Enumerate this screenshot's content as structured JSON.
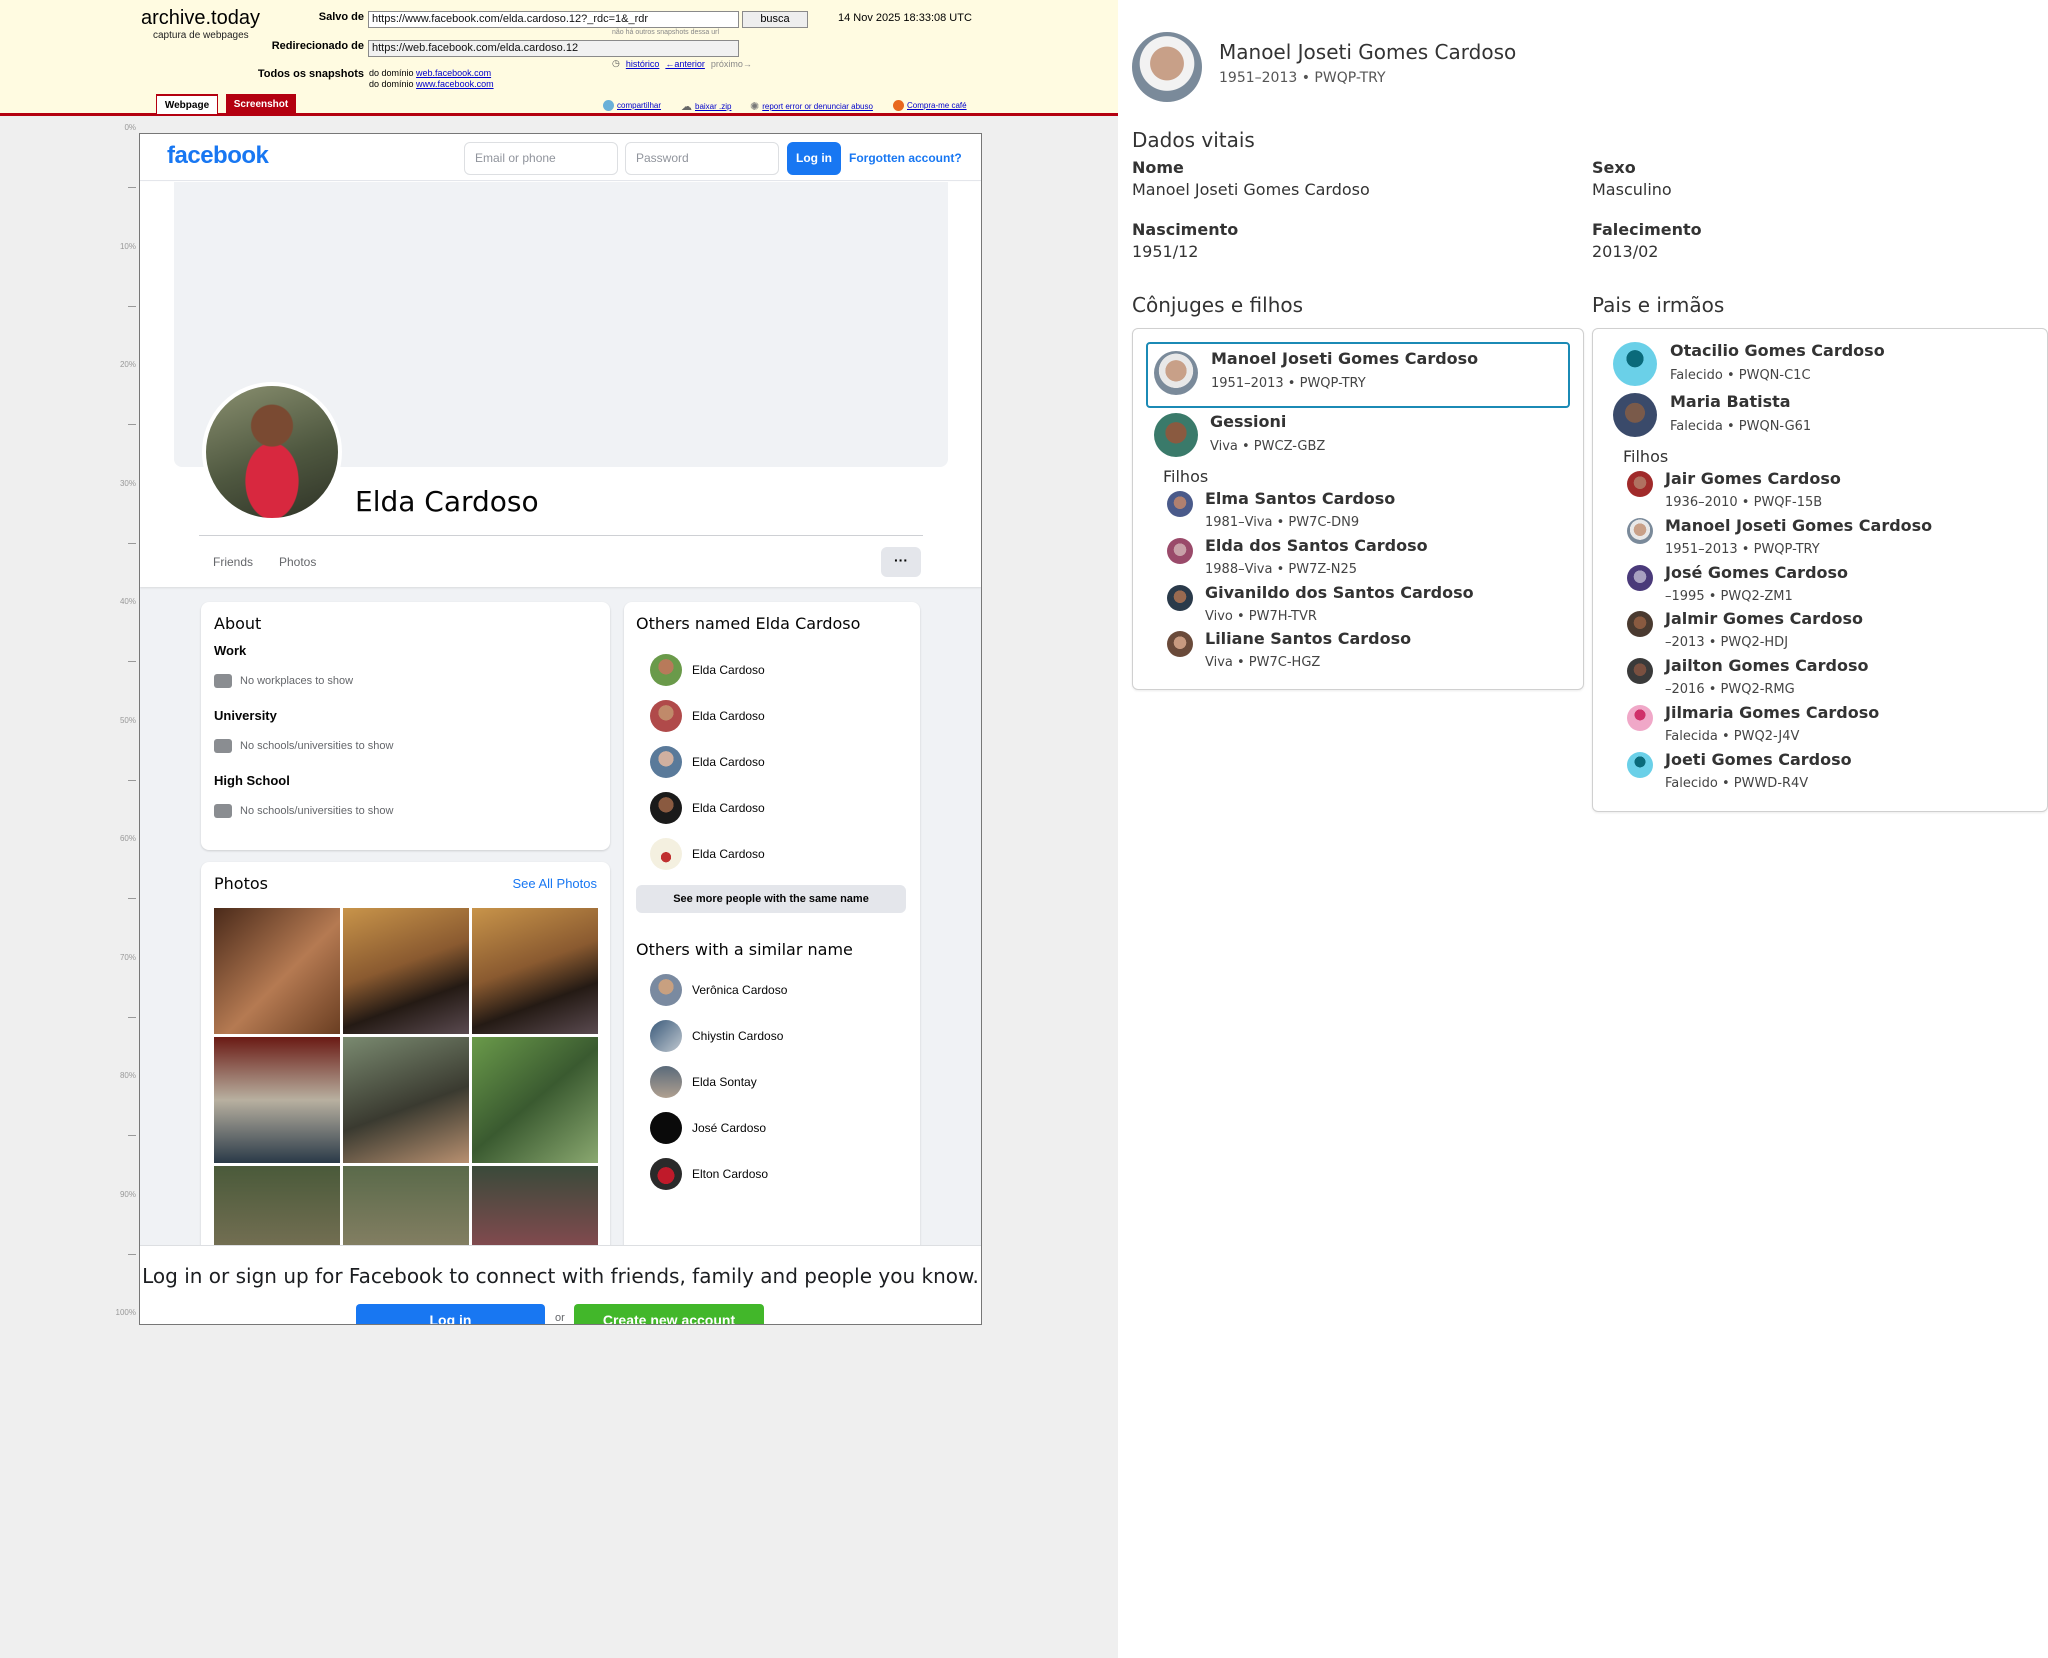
{
  "archive": {
    "logo": "archive.today",
    "tagline": "captura de webpages",
    "saved_label": "Salvo de",
    "saved_url": "https://www.facebook.com/elda.cardoso.12?_rdc=1&_rdr",
    "search_button": "busca",
    "timestamp": "14 Nov 2025 18:33:08 UTC",
    "no_other_snapshots": "não há outros snapshots dessa url",
    "redirected_label": "Redirecionado de",
    "redirected_url": "https://web.facebook.com/elda.cardoso.12",
    "history_link": "histórico",
    "prev_link": "←anterior",
    "next_link": "próximo→",
    "all_snapshots_label": "Todos os snapshots",
    "domain_prefix_1": "do domínio",
    "domain_1": "web.facebook.com",
    "domain_prefix_2": "do domínio",
    "domain_2": "www.facebook.com",
    "tab_webpage": "Webpage",
    "tab_screenshot": "Screenshot",
    "share": "compartilhar",
    "download": "baixar .zip",
    "report": "report error or denunciar abuso",
    "coffee": "Compra-me café"
  },
  "ruler": [
    "0%",
    "10%",
    "20%",
    "30%",
    "40%",
    "50%",
    "60%",
    "70%",
    "80%",
    "90%",
    "100%"
  ],
  "facebook": {
    "logo": "facebook",
    "email_placeholder": "Email or phone",
    "password_placeholder": "Password",
    "login_button": "Log in",
    "forgot_link": "Forgotten account?",
    "profile_name": "Elda Cardoso",
    "tabs": [
      "Friends",
      "Photos"
    ],
    "more_button": "···",
    "about": {
      "title": "About",
      "work_label": "Work",
      "work_empty": "No workplaces to show",
      "university_label": "University",
      "university_empty": "No schools/universities to show",
      "highschool_label": "High School",
      "highschool_empty": "No schools/universities to show"
    },
    "photos": {
      "title": "Photos",
      "see_all": "See All Photos"
    },
    "others_named": {
      "title": "Others named Elda Cardoso",
      "people": [
        "Elda Cardoso",
        "Elda Cardoso",
        "Elda Cardoso",
        "Elda Cardoso",
        "Elda Cardoso"
      ],
      "see_more": "See more people with the same name"
    },
    "similar": {
      "title": "Others with a similar name",
      "people": [
        "Verônica Cardoso",
        "Chiystin Cardoso",
        "Elda Sontay",
        "José Cardoso",
        "Elton Cardoso"
      ]
    },
    "bottom": {
      "message": "Log in or sign up for Facebook to connect with friends, family and people you know.",
      "login": "Log in",
      "or": "or",
      "create": "Create new account"
    }
  },
  "familysearch": {
    "person": {
      "name": "Manoel Joseti Gomes Cardoso",
      "meta": "1951–2013 • PWQP-TRY"
    },
    "vitals": {
      "title": "Dados vitais",
      "name_label": "Nome",
      "name_value": "Manoel Joseti Gomes Cardoso",
      "sex_label": "Sexo",
      "sex_value": "Masculino",
      "birth_label": "Nascimento",
      "birth_value": "1951/12",
      "death_label": "Falecimento",
      "death_value": "2013/02"
    },
    "spouses": {
      "title": "Cônjuges e filhos",
      "husband": {
        "name": "Manoel Joseti Gomes Cardoso",
        "meta": "1951–2013 • PWQP-TRY"
      },
      "wife": {
        "name": "Gessioni",
        "meta": "Viva • PWCZ-GBZ"
      },
      "children_label": "Filhos",
      "children": [
        {
          "name": "Elma Santos Cardoso",
          "meta": "1981–Viva • PW7C-DN9"
        },
        {
          "name": "Elda dos Santos Cardoso",
          "meta": "1988–Viva • PW7Z-N25"
        },
        {
          "name": "Givanildo dos Santos Cardoso",
          "meta": "Vivo • PW7H-TVR"
        },
        {
          "name": "Liliane Santos Cardoso",
          "meta": "Viva • PW7C-HGZ"
        }
      ]
    },
    "parents": {
      "title": "Pais e irmãos",
      "father": {
        "name": "Otacilio Gomes Cardoso",
        "meta": "Falecido • PWQN-C1C"
      },
      "mother": {
        "name": "Maria Batista",
        "meta": "Falecida • PWQN-G61"
      },
      "children_label": "Filhos",
      "children": [
        {
          "name": "Jair Gomes Cardoso",
          "meta": "1936–2010 • PWQF-15B"
        },
        {
          "name": "Manoel Joseti Gomes Cardoso",
          "meta": "1951–2013 • PWQP-TRY"
        },
        {
          "name": "José Gomes Cardoso",
          "meta": "–1995 • PWQ2-ZM1"
        },
        {
          "name": "Jalmir Gomes Cardoso",
          "meta": "–2013 • PWQ2-HDJ"
        },
        {
          "name": "Jailton Gomes Cardoso",
          "meta": "–2016 • PWQ2-RMG"
        },
        {
          "name": "Jilmaria Gomes Cardoso",
          "meta": "Falecida • PWQ2-J4V"
        },
        {
          "name": "Joeti Gomes Cardoso",
          "meta": "Falecido • PWWD-R4V"
        }
      ]
    }
  }
}
